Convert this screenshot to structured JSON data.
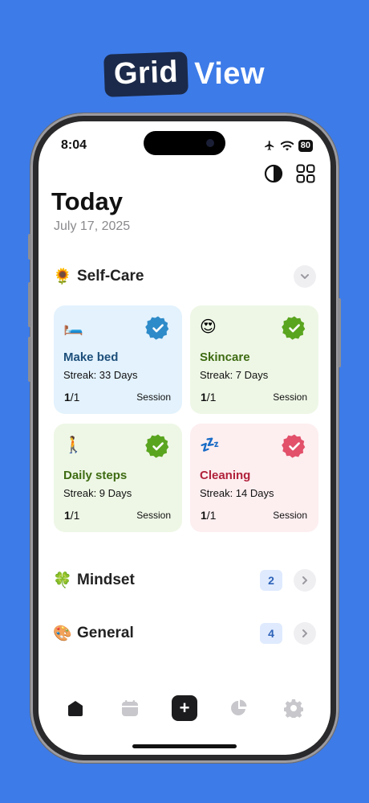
{
  "promo": {
    "highlight": "Grid",
    "word": "View"
  },
  "status_bar": {
    "time": "8:04",
    "battery": "80",
    "airplane_icon": "airplane-icon",
    "wifi_icon": "wifi-icon"
  },
  "header": {
    "title": "Today",
    "date": "July 17, 2025"
  },
  "sections": [
    {
      "emoji": "🌻",
      "name": "Self-Care",
      "expanded": true
    },
    {
      "emoji": "🍀",
      "name": "Mindset",
      "count": "2"
    },
    {
      "emoji": "🎨",
      "name": "General",
      "count": "4"
    }
  ],
  "habits": [
    {
      "emoji": "🛏️",
      "name": "Make bed",
      "streak": "Streak: 33 Days",
      "done": "1",
      "total": "/1",
      "unit": "Session",
      "bg": "#e3f2fd",
      "name_color": "#1d4f7a",
      "check_color": "#2e8bc9"
    },
    {
      "emoji": "😍",
      "name": "Skincare",
      "streak": "Streak: 7 Days",
      "done": "1",
      "total": "/1",
      "unit": "Session",
      "bg": "#eef7e6",
      "name_color": "#3e6b12",
      "check_color": "#5aa51f"
    },
    {
      "emoji": "🚶",
      "name": "Daily steps",
      "streak": "Streak: 9 Days",
      "done": "1",
      "total": "/1",
      "unit": "Session",
      "bg": "#eef7e6",
      "name_color": "#3e6b12",
      "check_color": "#5aa51f"
    },
    {
      "emoji": "💤",
      "name": "Cleaning",
      "streak": "Streak: 14 Days",
      "done": "1",
      "total": "/1",
      "unit": "Session",
      "bg": "#fdeef0",
      "name_color": "#b0213a",
      "check_color": "#e2506a"
    }
  ],
  "nav": [
    "home-icon",
    "calendar-icon",
    "add-icon",
    "stats-icon",
    "settings-icon"
  ],
  "colors": {
    "background": "#3d7be8",
    "accent_dark": "#1b2a4a",
    "badge_bg": "#dfeafe",
    "badge_text": "#2d62b8"
  }
}
